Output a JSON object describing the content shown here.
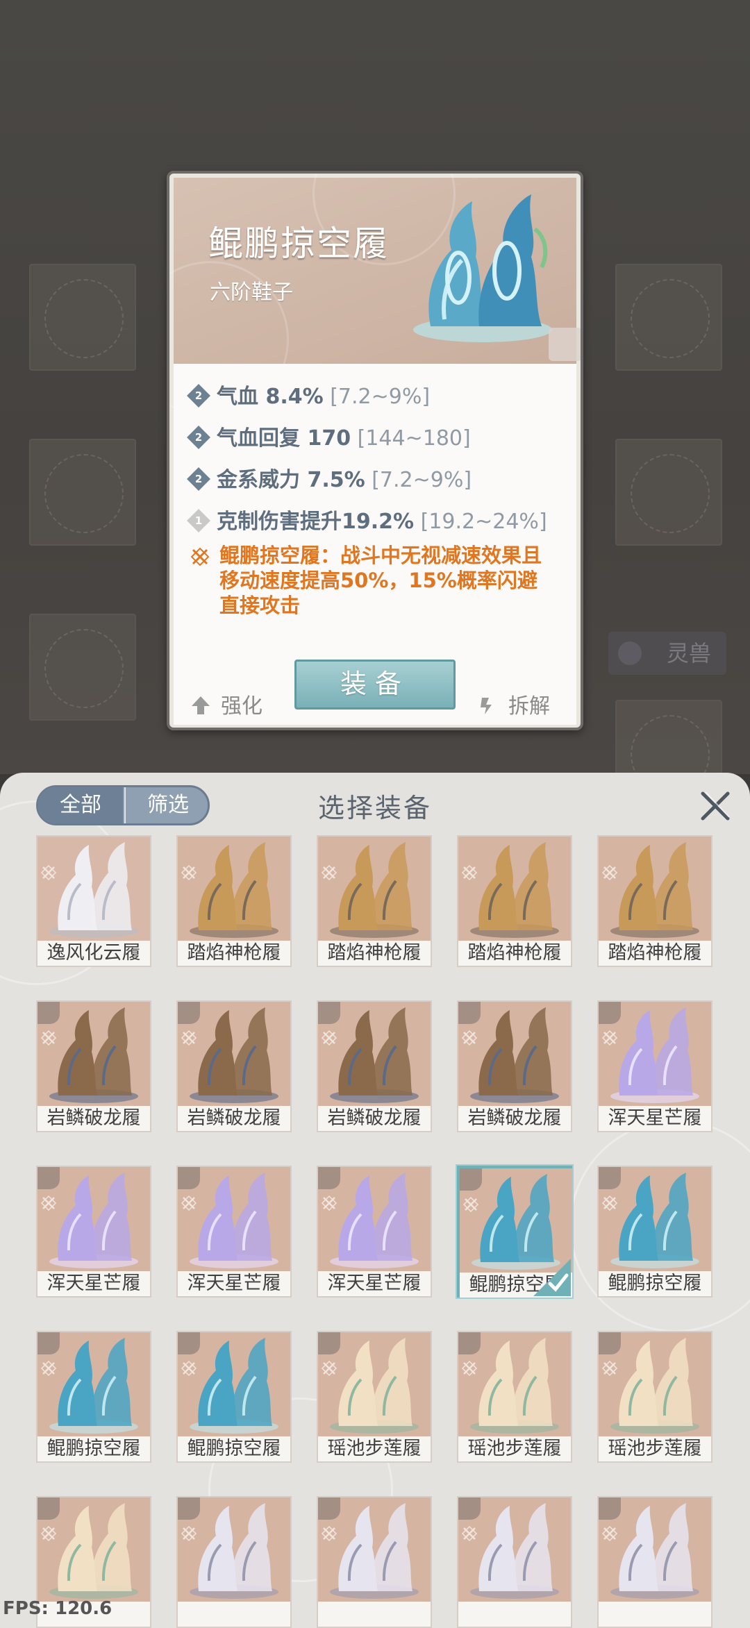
{
  "background": {
    "side_tag": "灵兽"
  },
  "detail": {
    "name": "鲲鹏掠空履",
    "type": "六阶鞋子",
    "stats": [
      {
        "badge": "2",
        "text": "气血 8.4%",
        "range": "[7.2~9%]"
      },
      {
        "badge": "2",
        "text": "气血回复 170",
        "range": "[144~180]"
      },
      {
        "badge": "2",
        "text": "金系威力 7.5%",
        "range": "[7.2~9%]"
      },
      {
        "badge": "1",
        "text": "克制伤害提升19.2%",
        "range": "[19.2~24%]"
      }
    ],
    "special_line1": "鲲鹏掠空履：战斗中无视减速效果且",
    "special_line2": "移动速度提高50%，15%概率闪避",
    "special_line3": "直接攻击",
    "strengthen_label": "强化",
    "equip_label": "装备",
    "dismantle_label": "拆解"
  },
  "panel": {
    "title": "选择装备",
    "seg_all": "全部",
    "seg_filter": "筛选",
    "items": [
      {
        "label": "逸风化云履",
        "kind": "silver"
      },
      {
        "label": "踏焰神枪履",
        "kind": "gold"
      },
      {
        "label": "踏焰神枪履",
        "kind": "gold"
      },
      {
        "label": "踏焰神枪履",
        "kind": "gold"
      },
      {
        "label": "踏焰神枪履",
        "kind": "gold"
      },
      {
        "label": "岩鳞破龙履",
        "kind": "bronze"
      },
      {
        "label": "岩鳞破龙履",
        "kind": "bronze"
      },
      {
        "label": "岩鳞破龙履",
        "kind": "bronze"
      },
      {
        "label": "岩鳞破龙履",
        "kind": "bronze"
      },
      {
        "label": "浑天星芒履",
        "kind": "violet"
      },
      {
        "label": "浑天星芒履",
        "kind": "violet"
      },
      {
        "label": "浑天星芒履",
        "kind": "violet"
      },
      {
        "label": "浑天星芒履",
        "kind": "violet"
      },
      {
        "label": "鲲鹏掠空履",
        "kind": "teal",
        "selected": true
      },
      {
        "label": "鲲鹏掠空履",
        "kind": "teal"
      },
      {
        "label": "鲲鹏掠空履",
        "kind": "teal"
      },
      {
        "label": "鲲鹏掠空履",
        "kind": "teal"
      },
      {
        "label": "瑶池步莲履",
        "kind": "lotus"
      },
      {
        "label": "瑶池步莲履",
        "kind": "lotus"
      },
      {
        "label": "瑶池步莲履",
        "kind": "lotus"
      },
      {
        "label": "",
        "kind": "lotus"
      },
      {
        "label": "",
        "kind": "frost"
      },
      {
        "label": "",
        "kind": "frost"
      },
      {
        "label": "",
        "kind": "frost"
      },
      {
        "label": "",
        "kind": "frost"
      }
    ]
  },
  "fps": "FPS: 120.6",
  "colors": {
    "accent": "#79b1b7",
    "special_text": "#e0761f",
    "stat_text": "#5e6e7e"
  }
}
